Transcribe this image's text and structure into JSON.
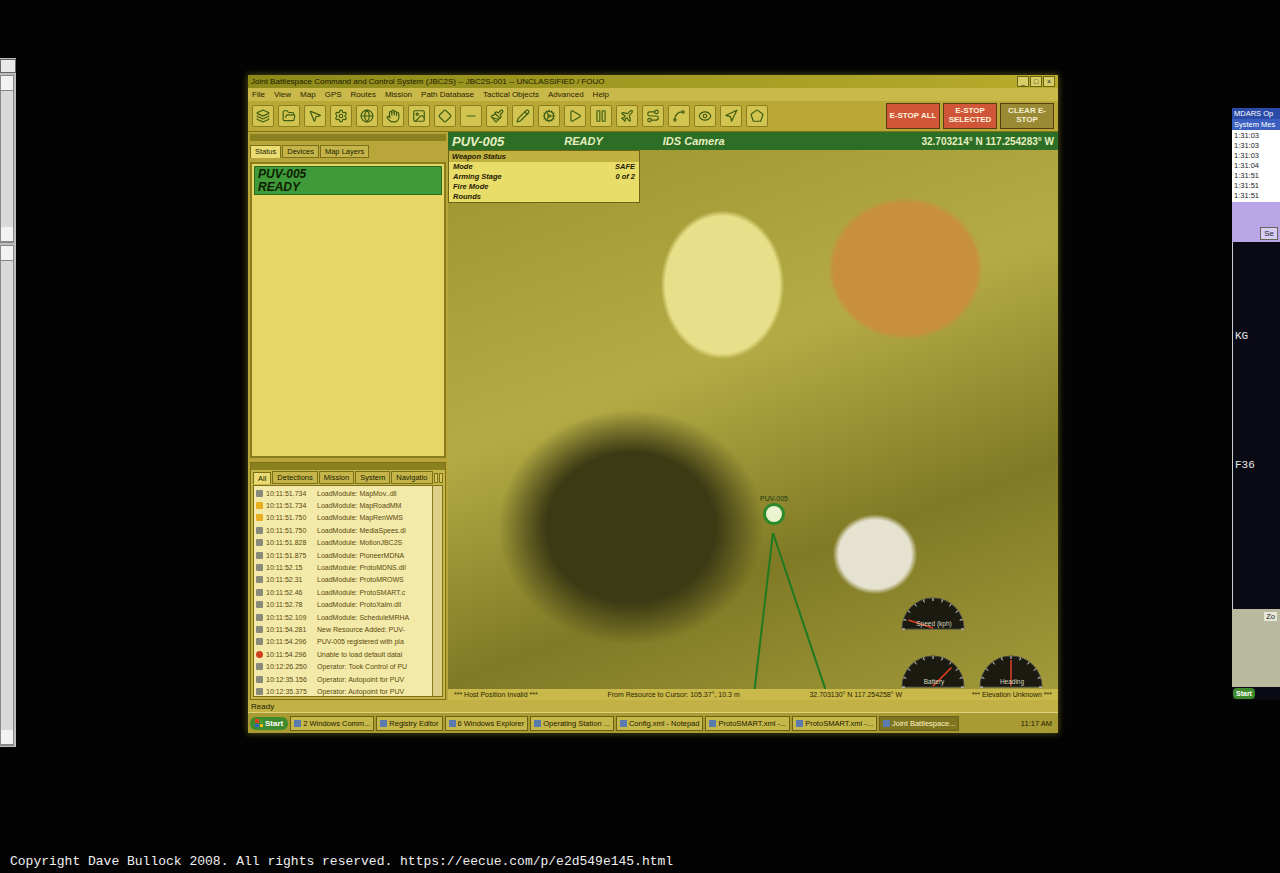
{
  "window": {
    "title": "Joint Battlespace Command and Control System (JBC2S) -- JBC2S-001 -- UNCLASSIFIED / FOUO",
    "controls": [
      "_",
      "□",
      "×"
    ]
  },
  "menu": [
    "File",
    "View",
    "Map",
    "GPS",
    "Routes",
    "Mission",
    "Path Database",
    "Tactical Objects",
    "Advanced",
    "Help"
  ],
  "estop_buttons": [
    {
      "label": "E-STOP ALL"
    },
    {
      "label": "E-STOP SELECTED"
    },
    {
      "label": "CLEAR E-STOP"
    }
  ],
  "vehicle_header": {
    "name": "PUV-005",
    "state": "READY",
    "camera": "IDS Camera",
    "coords": "32.703214° N 117.254283° W"
  },
  "weapon_status": {
    "title": "Weapon Status",
    "rows": [
      {
        "label": "Mode",
        "value": "SAFE"
      },
      {
        "label": "Arming Stage",
        "value": "0 of 2"
      },
      {
        "label": "Fire Mode",
        "value": ""
      },
      {
        "label": "Rounds",
        "value": ""
      }
    ]
  },
  "side_panel": {
    "tabs": [
      {
        "label": "Status",
        "selected": true
      },
      {
        "label": "Devices",
        "selected": false
      },
      {
        "label": "Map Layers",
        "selected": false
      }
    ],
    "items": [
      {
        "name": "PUV-005",
        "status": "READY",
        "selected": true
      }
    ]
  },
  "log": {
    "tabs": [
      {
        "label": "All",
        "selected": true
      },
      {
        "label": "Detections",
        "selected": false
      },
      {
        "label": "Mission",
        "selected": false
      },
      {
        "label": "System",
        "selected": false
      },
      {
        "label": "Navigatio",
        "selected": false
      }
    ],
    "rows": [
      {
        "time": "10:11:51.734",
        "message": "LoadModule: MapMov..dll",
        "kind": "info"
      },
      {
        "time": "10:11:51.734",
        "message": "LoadModule: MapRoadMM",
        "kind": "warning"
      },
      {
        "time": "10:11:51.750",
        "message": "LoadModule: MapRenWMS",
        "kind": "warning"
      },
      {
        "time": "10:11:51.750",
        "message": "LoadModule: MediaSpees.dl",
        "kind": "info"
      },
      {
        "time": "10:11:51.828",
        "message": "LoadModule: MotionJBC2S",
        "kind": "info"
      },
      {
        "time": "10:11:51.875",
        "message": "LoadModule: PioneerMDNA",
        "kind": "info"
      },
      {
        "time": "10:11:52.15",
        "message": "LoadModule: ProtoMDNS.dll",
        "kind": "info"
      },
      {
        "time": "10:11:52.31",
        "message": "LoadModule: ProtoMROWS",
        "kind": "info"
      },
      {
        "time": "10:11:52.46",
        "message": "LoadModule: ProtoSMART.c",
        "kind": "info"
      },
      {
        "time": "10:11:52.78",
        "message": "LoadModule: ProtoXalm.dll",
        "kind": "info"
      },
      {
        "time": "10:11:52.109",
        "message": "LoadModule: ScheduleMRHA",
        "kind": "info"
      },
      {
        "time": "10:11:54.281",
        "message": "New Resource Added: PUV-",
        "kind": "info"
      },
      {
        "time": "10:11:54.296",
        "message": "PUV-005 registered with pla",
        "kind": "info"
      },
      {
        "time": "10:11:54.296",
        "message": "Unable to load default datal",
        "kind": "error"
      },
      {
        "time": "10:12:26.250",
        "message": "Operator: Took Control of PU",
        "kind": "info"
      },
      {
        "time": "10:12:35.156",
        "message": "Operator: Autopoint for PUV",
        "kind": "info"
      },
      {
        "time": "10:12:35.375",
        "message": "Operator: Autopoint for PUV",
        "kind": "info"
      }
    ]
  },
  "map": {
    "marker_label": "PUV-005",
    "gauges": [
      {
        "label": "Speed (kph)",
        "level": 0.1
      },
      {
        "label": "Battery",
        "level": 0.75
      },
      {
        "label": "Heading",
        "level": 0.5
      }
    ]
  },
  "map_status": [
    "*** Host Position Invalid ***",
    "From Resource to Cursor: 105.37°, 10.3 m",
    "32.703130° N 117.254258° W",
    "*** Elevation Unknown ***"
  ],
  "status_bar": "Ready",
  "taskbar": {
    "start": "Start",
    "tasks": [
      {
        "label": "2 Windows Comm...",
        "selected": false
      },
      {
        "label": "Registry Editor",
        "selected": false
      },
      {
        "label": "6 Windows Explorer",
        "selected": false
      },
      {
        "label": "Operating Station ...",
        "selected": false
      },
      {
        "label": "Config.xml - Notepad",
        "selected": false
      },
      {
        "label": "ProtoSMART.xml -...",
        "selected": false
      },
      {
        "label": "ProtoSMART.xml -...",
        "selected": false
      },
      {
        "label": "Joint Battlespace...",
        "selected": true
      }
    ],
    "clock": "11:17 AM"
  },
  "right_window": {
    "title": "MDARS Op",
    "header": "System Mes",
    "times": [
      "1:31:03",
      "1:31:03",
      "1:31:03",
      "1:31:04",
      "1:31:51",
      "1:31:51",
      "1:31:51"
    ],
    "button": "Se",
    "map_labels": [
      "KG",
      "F36"
    ],
    "footer_label": "Zo",
    "start": "Start"
  },
  "copyright": "Copyright Dave Bullock 2008. All rights reserved. https://eecue.com/p/e2d549e145.html"
}
